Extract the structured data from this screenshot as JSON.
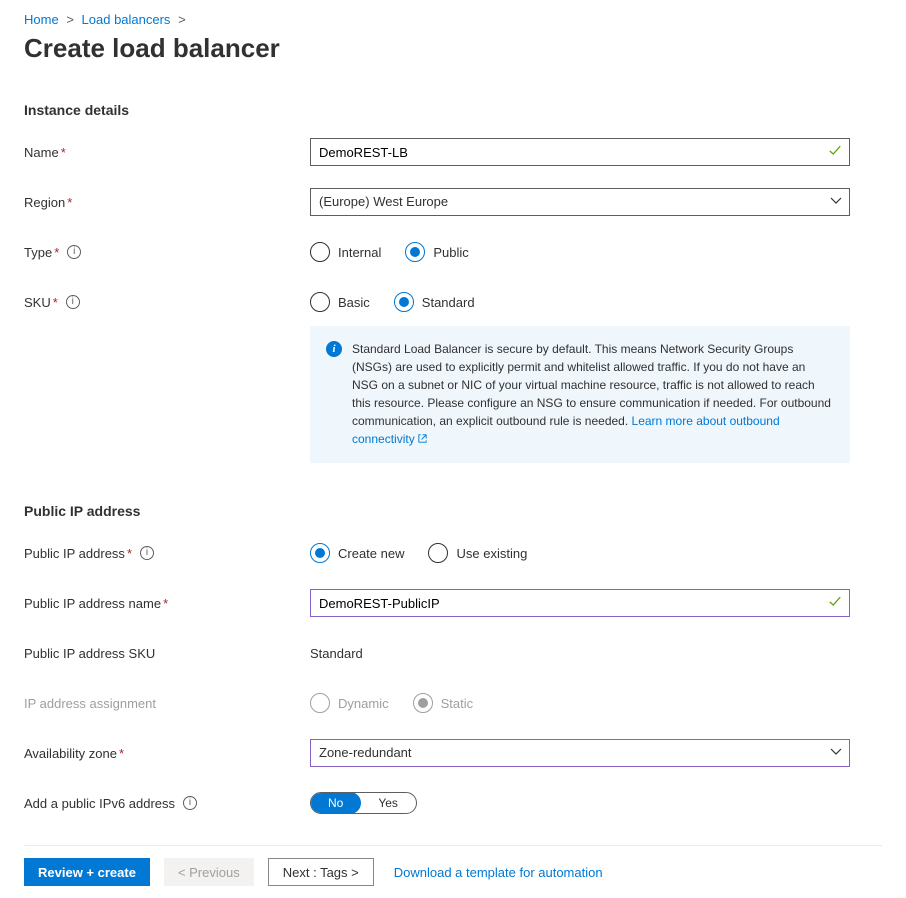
{
  "breadcrumb": {
    "home": "Home",
    "loadbalancers": "Load balancers"
  },
  "page_title": "Create load balancer",
  "sections": {
    "instance_details": {
      "title": "Instance details",
      "name_label": "Name",
      "name_value": "DemoREST-LB",
      "region_label": "Region",
      "region_value": "(Europe) West Europe",
      "type_label": "Type",
      "type_options": {
        "internal": "Internal",
        "public": "Public"
      },
      "sku_label": "SKU",
      "sku_options": {
        "basic": "Basic",
        "standard": "Standard"
      },
      "info_text": "Standard Load Balancer is secure by default.  This means Network Security Groups (NSGs) are used to explicitly permit and whitelist allowed traffic. If you do not have an NSG on a subnet or NIC of your virtual machine resource, traffic is not allowed to reach this resource. Please configure an NSG to ensure communication if needed.  For outbound communication, an explicit outbound rule is needed. ",
      "info_link": "Learn more about outbound connectivity"
    },
    "public_ip": {
      "title": "Public IP address",
      "pip_label": "Public IP address",
      "pip_options": {
        "create_new": "Create new",
        "use_existing": "Use existing"
      },
      "pip_name_label": "Public IP address name",
      "pip_name_value": "DemoREST-PublicIP",
      "pip_sku_label": "Public IP address SKU",
      "pip_sku_value": "Standard",
      "ip_assign_label": "IP address assignment",
      "ip_assign_options": {
        "dynamic": "Dynamic",
        "static": "Static"
      },
      "az_label": "Availability zone",
      "az_value": "Zone-redundant",
      "ipv6_label": "Add a public IPv6 address",
      "ipv6_options": {
        "no": "No",
        "yes": "Yes"
      }
    }
  },
  "footer": {
    "review_create": "Review + create",
    "previous": "< Previous",
    "next": "Next : Tags >",
    "download_template": "Download a template for automation"
  }
}
